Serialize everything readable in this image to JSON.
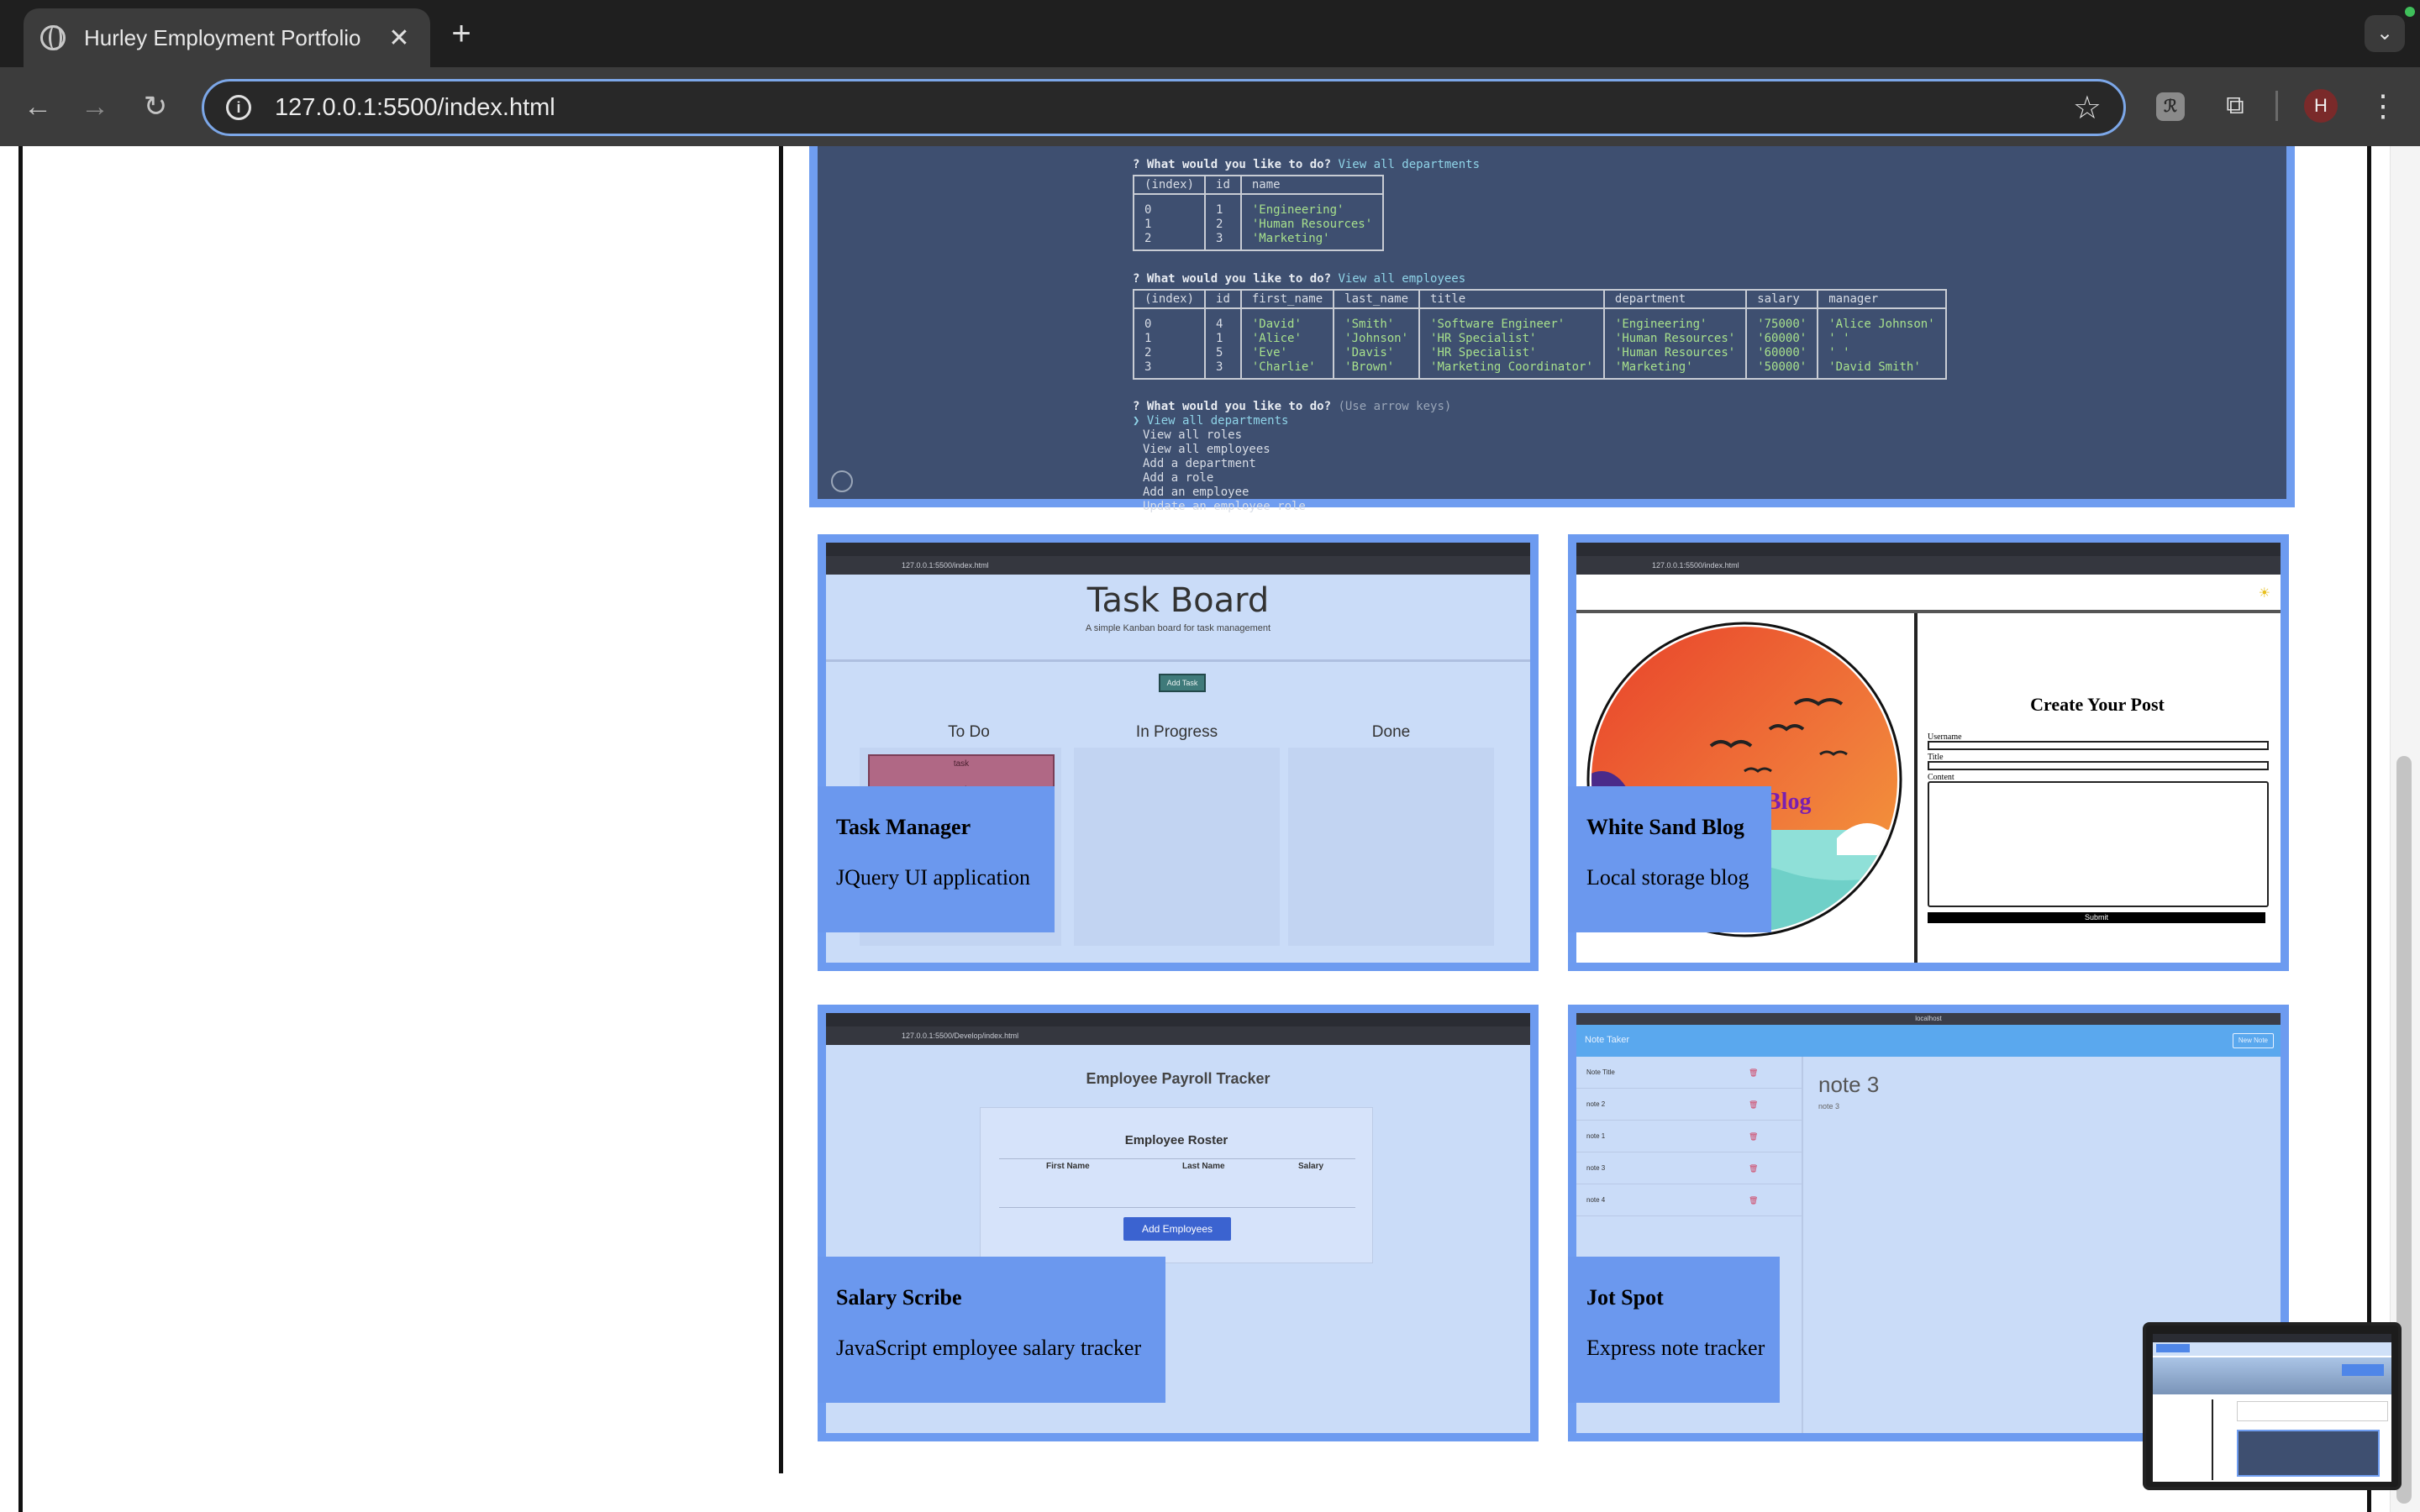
{
  "browser": {
    "tab_title": "Hurley Employment Portfolio",
    "url": "127.0.0.1:5500/index.html",
    "avatar_letter": "H"
  },
  "terminal": {
    "prompt1": "? What would you like to do? ",
    "answer1": "View all departments",
    "dept_headers": [
      "(index)",
      "id",
      "name"
    ],
    "dept_rows": [
      [
        "0",
        "1",
        "'Engineering'"
      ],
      [
        "1",
        "2",
        "'Human Resources'"
      ],
      [
        "2",
        "3",
        "'Marketing'"
      ]
    ],
    "prompt2": "? What would you like to do? ",
    "answer2": "View all employees",
    "emp_headers": [
      "(index)",
      "id",
      "first_name",
      "last_name",
      "title",
      "department",
      "salary",
      "manager"
    ],
    "emp_rows": [
      [
        "0",
        "4",
        "'David'",
        "'Smith'",
        "'Software Engineer'",
        "'Engineering'",
        "'75000'",
        "'Alice Johnson'"
      ],
      [
        "1",
        "1",
        "'Alice'",
        "'Johnson'",
        "'HR Specialist'",
        "'Human Resources'",
        "'60000'",
        "' '"
      ],
      [
        "2",
        "5",
        "'Eve'",
        "'Davis'",
        "'HR Specialist'",
        "'Human Resources'",
        "'60000'",
        "' '"
      ],
      [
        "3",
        "3",
        "'Charlie'",
        "'Brown'",
        "'Marketing Coordinator'",
        "'Marketing'",
        "'50000'",
        "'David Smith'"
      ]
    ],
    "prompt3": "? What would you like to do? ",
    "hint3": "(Use arrow keys)",
    "menu_selected": "❯ View all departments",
    "menu_items": [
      "View all roles",
      "View all employees",
      "Add a department",
      "Add a role",
      "Add an employee",
      "Update an employee role"
    ]
  },
  "cards": {
    "task_manager": {
      "title": "Task Manager",
      "desc": "JQuery UI application",
      "shot": {
        "url": "127.0.0.1:5500/index.html",
        "heading": "Task Board",
        "subheading": "A simple Kanban board for task management",
        "add_button": "Add Task",
        "columns": [
          "To Do",
          "In Progress",
          "Done"
        ],
        "task_card_lines": [
          "task",
          "task"
        ]
      }
    },
    "white_sand": {
      "title": "White Sand Blog",
      "desc": "Local storage blog",
      "shot": {
        "url": "127.0.0.1:5500/index.html",
        "logo_text": "Blog",
        "form_title": "Create Your Post",
        "username_label": "Username",
        "title_label": "Title",
        "content_label": "Content",
        "submit_label": "Submit"
      }
    },
    "salary_scribe": {
      "title": "Salary Scribe",
      "desc": "JavaScript employee salary tracker",
      "shot": {
        "url": "127.0.0.1:5500/Develop/index.html",
        "heading": "Employee Payroll Tracker",
        "roster_title": "Employee Roster",
        "columns": [
          "First Name",
          "Last Name",
          "Salary"
        ],
        "button": "Add Employees"
      }
    },
    "jot_spot": {
      "title": "Jot Spot",
      "desc": "Express note tracker",
      "shot": {
        "address": "localhost",
        "app_title": "Note Taker",
        "new_note": "New Note",
        "notes": [
          "Note Title",
          "note 2",
          "note 1",
          "note 3",
          "note 4"
        ],
        "active_title": "note 3",
        "active_body": "note 3"
      }
    }
  },
  "colors": {
    "card_border": "#6d9bf0",
    "card_label": "#6b98ee",
    "terminal_bg": "#3e4f70",
    "shot_bg": "#cadcf8"
  }
}
